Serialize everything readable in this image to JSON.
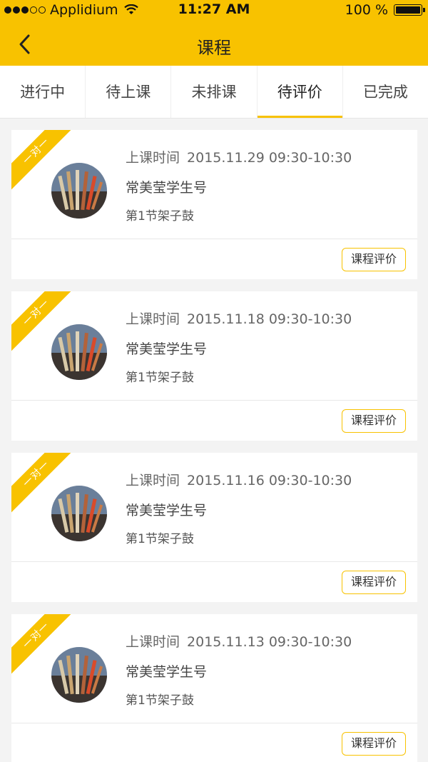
{
  "status_bar": {
    "carrier": "Applidium",
    "time": "11:27 AM",
    "battery": "100 %"
  },
  "nav": {
    "title": "课程",
    "back_icon": "chevron-left-icon"
  },
  "tabs": [
    {
      "label": "进行中",
      "active": false
    },
    {
      "label": "待上课",
      "active": false
    },
    {
      "label": "未排课",
      "active": false
    },
    {
      "label": "待评价",
      "active": true
    },
    {
      "label": "已完成",
      "active": false
    }
  ],
  "colors": {
    "accent": "#f8c200",
    "background": "#f3f3f3"
  },
  "lessons": [
    {
      "ribbon": "一对一",
      "time_label": "上课时间",
      "time": "2015.11.29 09:30-10:30",
      "student": "常美莹学生号",
      "lesson": "第1节架子鼓",
      "action": "课程评价"
    },
    {
      "ribbon": "一对一",
      "time_label": "上课时间",
      "time": "2015.11.18 09:30-10:30",
      "student": "常美莹学生号",
      "lesson": "第1节架子鼓",
      "action": "课程评价"
    },
    {
      "ribbon": "一对一",
      "time_label": "上课时间",
      "time": "2015.11.16 09:30-10:30",
      "student": "常美莹学生号",
      "lesson": "第1节架子鼓",
      "action": "课程评价"
    },
    {
      "ribbon": "一对一",
      "time_label": "上课时间",
      "time": "2015.11.13 09:30-10:30",
      "student": "常美莹学生号",
      "lesson": "第1节架子鼓",
      "action": "课程评价"
    }
  ]
}
